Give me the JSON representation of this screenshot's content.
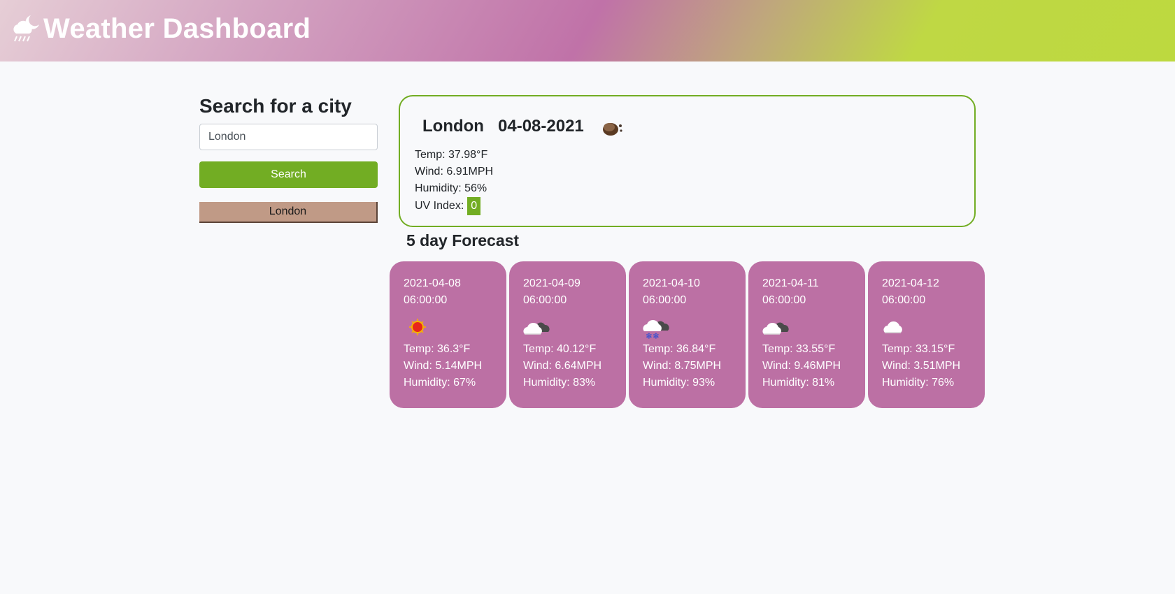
{
  "header": {
    "title": "Weather Dashboard",
    "icon": "cloud-moon-rain-icon"
  },
  "sidebar": {
    "heading": "Search for a city",
    "search_value": "London",
    "search_button": "Search",
    "history": [
      "London"
    ]
  },
  "current": {
    "city": "London",
    "date": "04-08-2021",
    "icon": "overcast-night-icon",
    "temp": "Temp: 37.98°F",
    "wind": "Wind: 6.91MPH",
    "humidity": "Humidity: 56%",
    "uv_label": "UV Index:",
    "uv_value": "0",
    "uv_color": "#72ad23"
  },
  "forecast": {
    "heading": "5 day Forecast",
    "days": [
      {
        "date": "2021-04-08 06:00:00",
        "icon": "sun-icon",
        "temp": "Temp: 36.3°F",
        "wind": "Wind: 5.14MPH",
        "humidity": "Humidity: 67%"
      },
      {
        "date": "2021-04-09 06:00:00",
        "icon": "broken-clouds-icon",
        "temp": "Temp: 40.12°F",
        "wind": "Wind: 6.64MPH",
        "humidity": "Humidity: 83%"
      },
      {
        "date": "2021-04-10 06:00:00",
        "icon": "snow-icon",
        "temp": "Temp: 36.84°F",
        "wind": "Wind: 8.75MPH",
        "humidity": "Humidity: 93%"
      },
      {
        "date": "2021-04-11 06:00:00",
        "icon": "broken-clouds-icon",
        "temp": "Temp: 33.55°F",
        "wind": "Wind: 9.46MPH",
        "humidity": "Humidity: 81%"
      },
      {
        "date": "2021-04-12 06:00:00",
        "icon": "cloud-icon",
        "temp": "Temp: 33.15°F",
        "wind": "Wind: 3.51MPH",
        "humidity": "Humidity: 76%"
      }
    ]
  },
  "colors": {
    "accent_green": "#72ad23",
    "forecast_card": "#bc70a4",
    "history_button": "#c09a86"
  }
}
